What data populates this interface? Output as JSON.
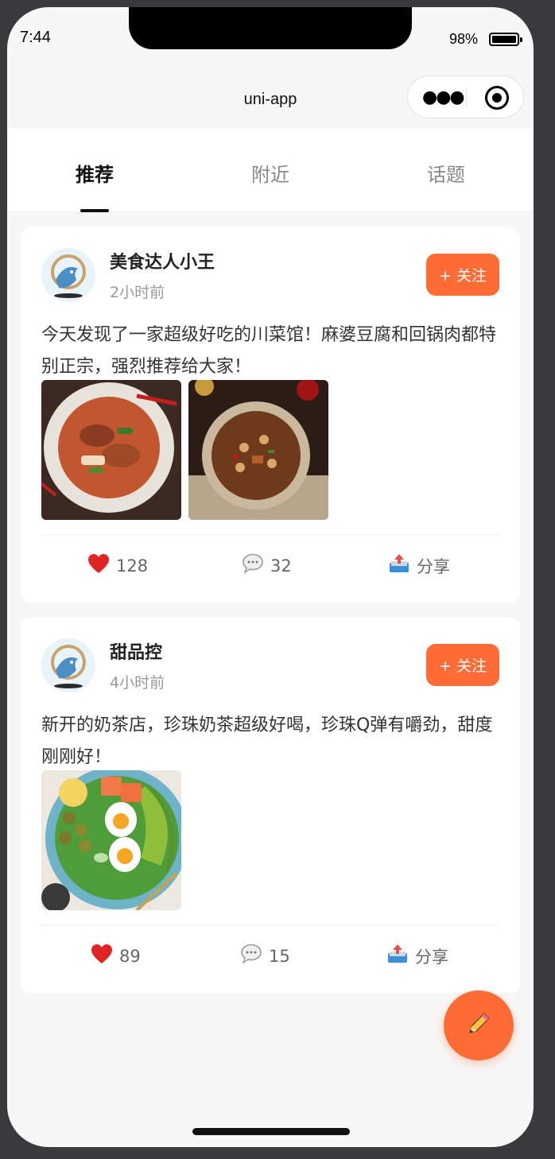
{
  "status_bar": {
    "time": "7:44",
    "battery": "98%"
  },
  "nav": {
    "title": "uni-app"
  },
  "tabs": [
    {
      "label": "推荐",
      "active": true
    },
    {
      "label": "附近",
      "active": false
    },
    {
      "label": "话题",
      "active": false
    }
  ],
  "posts": [
    {
      "author": "美食达人小王",
      "time": "2小时前",
      "follow_label": "+ 关注",
      "content": "今天发现了一家超级好吃的川菜馆！麻婆豆腐和回锅肉都特别正宗，强烈推荐给大家！",
      "likes": "128",
      "comments": "32",
      "share_label": "分享"
    },
    {
      "author": "甜品控",
      "time": "4小时前",
      "follow_label": "+ 关注",
      "content": "新开的奶茶店，珍珠奶茶超级好喝，珍珠Q弹有嚼劲，甜度刚刚好！",
      "likes": "89",
      "comments": "15",
      "share_label": "分享"
    }
  ],
  "colors": {
    "accent": "#ff6b35",
    "background": "#f7f7f7"
  }
}
